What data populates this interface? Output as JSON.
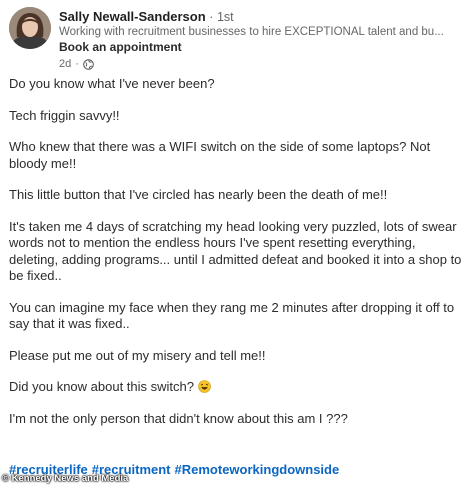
{
  "author": {
    "name": "Sally Newall-Sanderson",
    "connection": "1st",
    "headline": "Working with recruitment businesses to hire EXCEPTIONAL talent and bu...",
    "cta": "Book an appointment",
    "time": "2d",
    "visibility_icon": "globe-icon"
  },
  "post": {
    "paragraphs": [
      "Do you know what I've never been?",
      "Tech friggin savvy!!",
      "Who knew that there was a WIFI switch on the side of some laptops? Not bloody me!!",
      "This little button that I've circled has nearly been the death of me!!",
      "It's taken me 4 days of scratching my head looking very puzzled, lots of swear words not to mention the endless hours I've spent resetting everything, deleting, adding programs... until I admitted defeat and booked it into a shop to be fixed..",
      "You can imagine my face when they rang me 2 minutes after dropping it off to say that it was fixed..",
      "Please put me out of my misery and tell me!!",
      "Did you know about this switch?",
      "I'm not the only person that didn't know about this am I ???"
    ],
    "emoji_icon": "rolling-laughing-emoji",
    "hashtags": [
      "#recruiterlife",
      "#recruitment",
      "#Remoteworkingdownside"
    ]
  },
  "credit": "© Kennedy News and Media",
  "colors": {
    "hashtag": "#0a66c2",
    "text": "#2c2c2c",
    "muted": "#666666"
  }
}
